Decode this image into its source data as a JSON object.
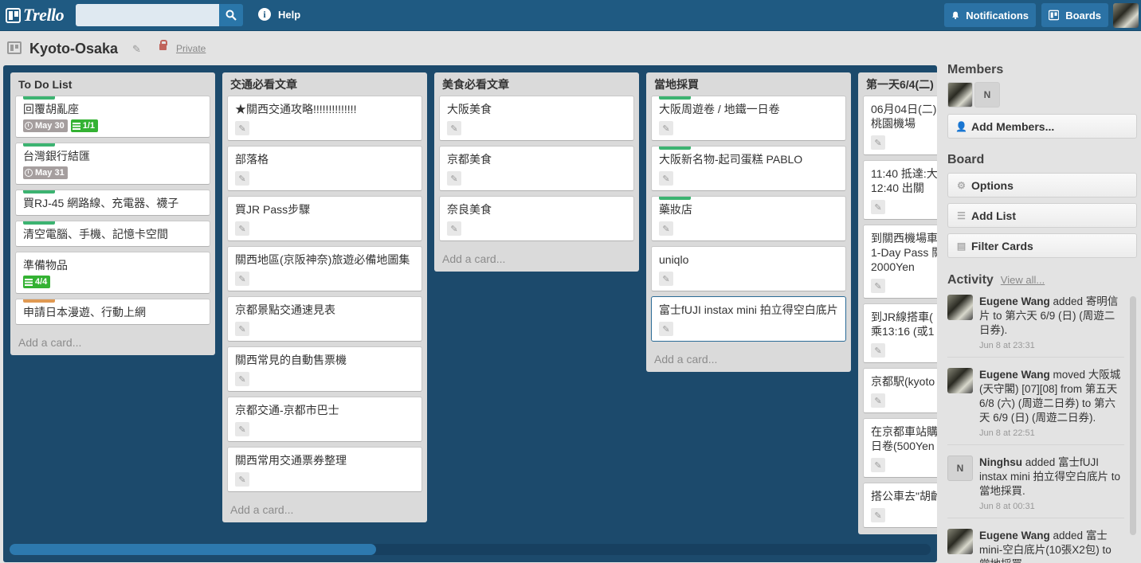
{
  "topbar": {
    "logo": "Trello",
    "search_value": "",
    "help": "Help",
    "notifications": "Notifications",
    "boards": "Boards"
  },
  "board": {
    "title": "Kyoto-Osaka",
    "privacy": "Private"
  },
  "lists": [
    {
      "title": "To Do List",
      "add_card": "Add a card...",
      "cards": [
        {
          "title": "回覆胡亂座",
          "label": "#3cb371",
          "due": "May 30",
          "checklist": "1/1"
        },
        {
          "title": "台灣銀行結匯",
          "label": "#3cb371",
          "due": "May 31"
        },
        {
          "title": "買RJ-45 網路線、充電器、襪子",
          "label": "#3cb371"
        },
        {
          "title": "清空電腦、手機、記憶卡空間",
          "label": "#3cb371"
        },
        {
          "title": "準備物品",
          "checklist": "4/4"
        },
        {
          "title": "申請日本漫遊、行動上網",
          "label": "#e09952"
        }
      ]
    },
    {
      "title": "交通必看文章",
      "add_card": "Add a card...",
      "cards": [
        {
          "title": "★關西交通攻略!!!!!!!!!!!!!!"
        },
        {
          "title": "部落格"
        },
        {
          "title": "買JR Pass步驟"
        },
        {
          "title": "關西地區(京阪神奈)旅遊必備地圖集"
        },
        {
          "title": "京都景點交通速見表"
        },
        {
          "title": "關西常見的自動售票機"
        },
        {
          "title": "京都交通-京都市巴士"
        },
        {
          "title": "關西常用交通票券整理"
        }
      ]
    },
    {
      "title": "美食必看文章",
      "add_card": "Add a card...",
      "cards": [
        {
          "title": "大阪美食"
        },
        {
          "title": "京都美食"
        },
        {
          "title": "奈良美食"
        }
      ]
    },
    {
      "title": "當地採買",
      "add_card": "Add a card...",
      "cards": [
        {
          "title": "大阪周遊卷 / 地鐵一日卷",
          "label": "#3cb371"
        },
        {
          "title": "大阪新名物-起司蛋糕 PABLO",
          "label": "#3cb371"
        },
        {
          "title": "藥妝店",
          "label": "#3cb371"
        },
        {
          "title": "uniqlo"
        },
        {
          "title": "富士fUJI instax mini 拍立得空白底片",
          "selected": true
        }
      ]
    },
    {
      "title": "第一天6/4(二)",
      "add_card": "Add a card...",
      "cards": [
        {
          "title": "06月04日(二)\n桃園機場"
        },
        {
          "title": "11:40 抵達:大\n12:40 出關"
        },
        {
          "title": "到關西機場車\n1-Day Pass 關\n2000Yen"
        },
        {
          "title": "到JR線搭車(\n乘13:16 (或1"
        },
        {
          "title": "京都駅(kyoto"
        },
        {
          "title": "在京都車站購\n日卷(500Yen"
        },
        {
          "title": "搭公車去\"胡齡"
        }
      ]
    }
  ],
  "sidebar": {
    "members_title": "Members",
    "member_initial": "N",
    "add_members": "Add Members...",
    "board_title": "Board",
    "options": "Options",
    "add_list": "Add List",
    "filter_cards": "Filter Cards",
    "activity_title": "Activity",
    "view_all": "View all...",
    "activity": [
      {
        "avatar": "photo",
        "user": "Eugene Wang",
        "pre": " added ",
        "card": "寄明信片",
        "post": " to 第六天 6/9 (日) (周遊二日券).",
        "when": "Jun 8 at 23:31"
      },
      {
        "avatar": "photo",
        "user": "Eugene Wang",
        "pre": " moved ",
        "card": "大阪城(天守閣) [07][08]",
        "post": " from 第五天 6/8 (六) (周遊二日券) to 第六天 6/9 (日) (周遊二日券).",
        "when": "Jun 8 at 22:51"
      },
      {
        "avatar": "N",
        "user": "Ninghsu",
        "pre": " added ",
        "card": "富士fUJI instax mini",
        "post": " 拍立得空白底片 to 當地採買.",
        "when": "Jun 8 at 00:31"
      },
      {
        "avatar": "photo",
        "user": "Eugene Wang",
        "pre": " added ",
        "card": "富士mini-空白底片(10張X2包)",
        "post": " to 當地採買.",
        "when": ""
      }
    ]
  },
  "colors": {
    "header": "#1f5a82",
    "board_bg": "#1c4a6c",
    "green_label": "#3cb371",
    "orange_label": "#e09952"
  }
}
